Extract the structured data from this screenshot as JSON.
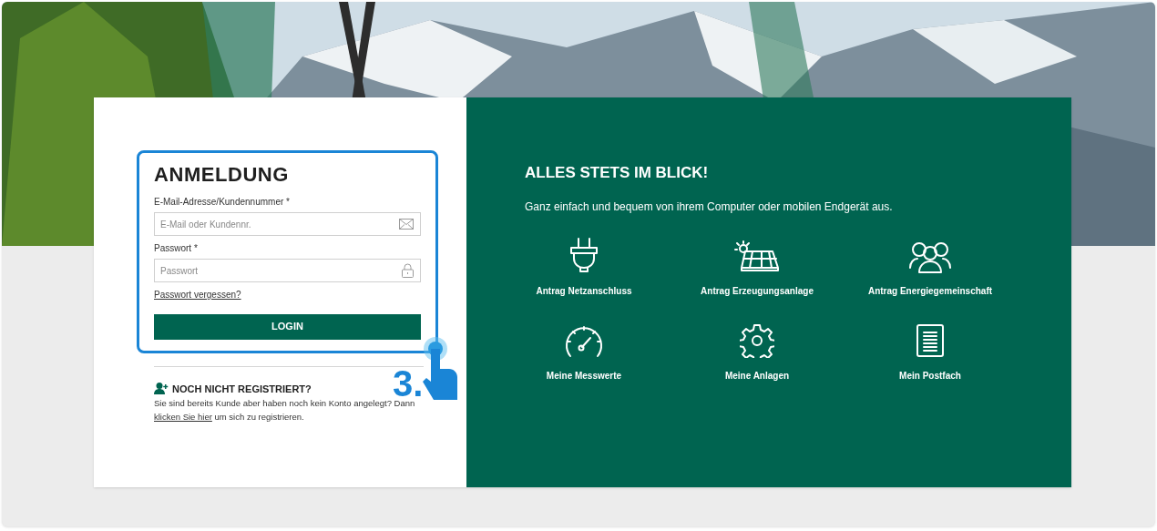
{
  "login": {
    "title": "ANMELDUNG",
    "fields": [
      {
        "label": "E-Mail-Adresse/Kundennummer *",
        "placeholder": "E-Mail oder Kundennr.",
        "kind": "email"
      },
      {
        "label": "Passwort *",
        "placeholder": "Passwort",
        "kind": "password"
      }
    ],
    "forgot_link": "Passwort vergessen?",
    "button": "LOGIN"
  },
  "annotation": {
    "step": "3."
  },
  "register": {
    "title": "NOCH NICHT REGISTRIERT?",
    "text": "Sie sind bereits Kunde aber haben noch kein Konto angelegt? Dann",
    "link": "klicken Sie hier",
    "text_after": "um sich zu registrieren."
  },
  "info": {
    "title": "ALLES STETS IM BLICK!",
    "subtitle": "Ganz einfach und bequem von ihrem Computer oder mobilen Endgerät aus.",
    "tiles": [
      {
        "kind": "plug",
        "label": "Antrag Netzanschluss"
      },
      {
        "kind": "solar",
        "label": "Antrag Erzeugungsanlage"
      },
      {
        "kind": "people",
        "label": "Antrag Energiegemeinschaft"
      },
      {
        "kind": "gauge",
        "label": "Meine Messwerte"
      },
      {
        "kind": "gear",
        "label": "Meine Anlagen"
      },
      {
        "kind": "document",
        "label": "Mein Postfach"
      }
    ]
  }
}
